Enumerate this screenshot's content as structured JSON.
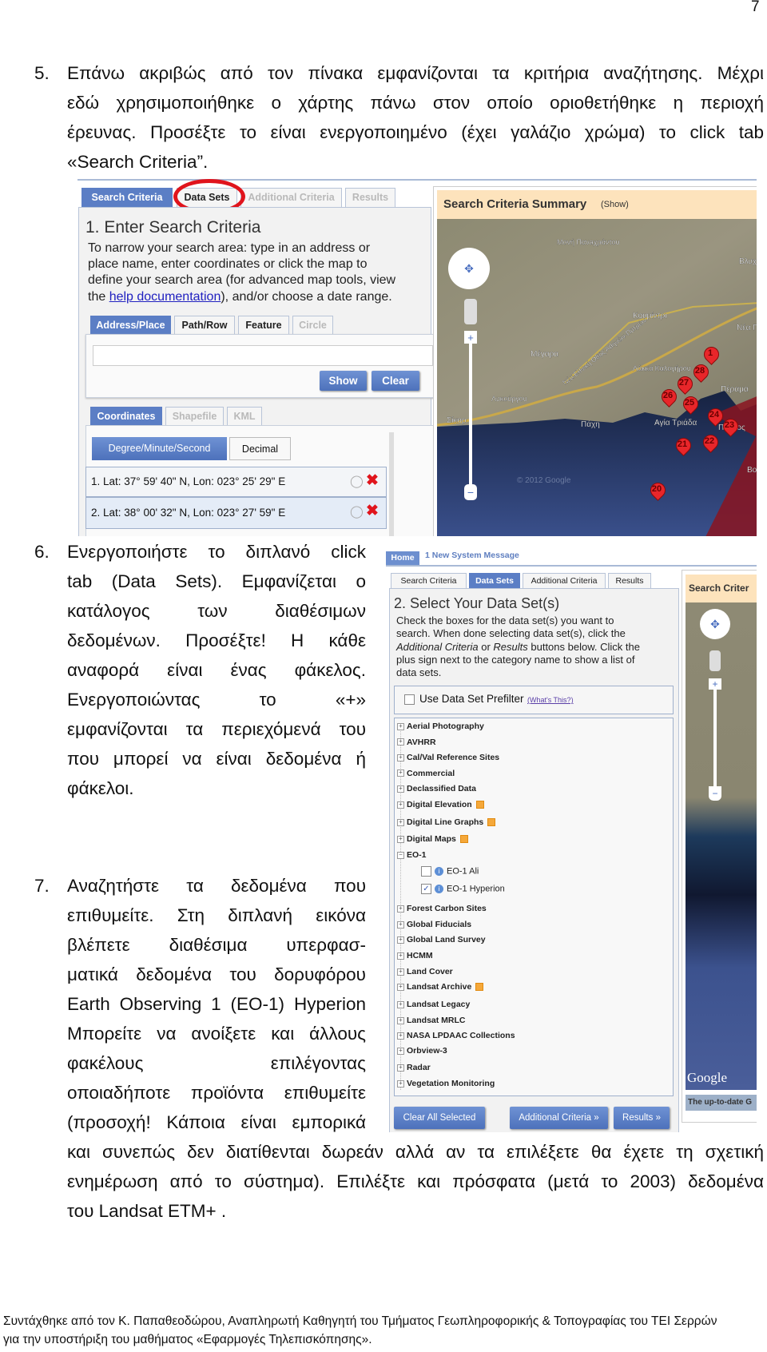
{
  "page_number": "7",
  "item5": {
    "number": "5.",
    "lines": [
      "Επάνω ακριβώς από τον πίνακα εμφανίζονται τα κριτήρια αναζήτησης. Μέχρι",
      "εδώ χρησιμοποιήθηκε ο χάρτης πάνω στον οποίο οριοθετήθηκε η περιοχή",
      "έρευνας. Προσέξτε το είναι ενεργοποιημένο (έχει γαλάζιο χρώμα) το click tab",
      "«Search Criteria”."
    ]
  },
  "shot1": {
    "tabs": [
      "Search Criteria",
      "Data Sets",
      "Additional Criteria",
      "Results"
    ],
    "active_tab": "Search Criteria",
    "highlight_color": "#e0141c",
    "heading": "1. Enter Search Criteria",
    "para": [
      "To narrow your search area: type in an address or",
      "place name, enter coordinates or click the map to",
      "define your search area (for advanced map tools, view"
    ],
    "para_last_pre": "the ",
    "help_link": "help documentation",
    "para_last_post": "), and/or choose a date range.",
    "subtabs": [
      "Address/Place",
      "Path/Row",
      "Feature",
      "Circle"
    ],
    "address_value": "",
    "show_button": "Show",
    "clear_button": "Clear",
    "coord_tabs": [
      "Coordinates",
      "Shapefile",
      "KML"
    ],
    "format_buttons": [
      "Degree/Minute/Second",
      "Decimal"
    ],
    "coordinates": [
      "1.  Lat: 37° 59' 40\" N, Lon: 023° 25' 29\" E",
      "2.  Lat: 38° 00' 32\" N, Lon: 023° 27' 59\" E"
    ],
    "summary_title": "Search Criteria Summary",
    "summary_show": "(Show)",
    "map_labels": [
      "Μονή Πανaχράντου",
      "Κουμίντρι",
      "Μέγαρα",
      "Λάκκα Καλογήρου",
      "Λυκούργου",
      "Σίκορ",
      "Πάχη",
      "Αγία Τριάδα",
      "Βλυχ",
      "Νέα Π",
      "Πέραμα",
      "Πύργος",
      "Βο",
      "Νέα Εθνική Οδός Αθηνών-Πατρών"
    ],
    "markers": [
      "1",
      "28",
      "27",
      "26",
      "25",
      "24",
      "23",
      "22",
      "21",
      "20"
    ],
    "watermark": "© 2012 Google"
  },
  "item6": {
    "number": "6.",
    "lines": [
      "Ενεργοποιήστε το διπλανό click",
      "tab (Data Sets). Εμφανίζεται ο",
      "κατάλογος των διαθέσιμων",
      "δεδομένων. Προσέξτε! Η κάθε",
      "αναφορά είναι ένας φάκελος.",
      "Ενεργοποιώντας το «+»",
      "εμφανίζονται τα περιεχόμενά του",
      "που μπορεί να είναι δεδομένα ή",
      "φάκελοι."
    ]
  },
  "shot2": {
    "home": "Home",
    "message": "1 New System Message",
    "tabs": [
      "Search Criteria",
      "Data Sets",
      "Additional Criteria",
      "Results"
    ],
    "active_tab": "Data Sets",
    "heading": "2. Select Your Data Set(s)",
    "para": [
      "Check the boxes for the data set(s) you want to",
      "search. When done selecting data set(s), click the"
    ],
    "para_i1": "Additional Criteria",
    "para_or": " or ",
    "para_i2": "Results",
    "para_rest": " buttons below. Click the",
    "para_tail": [
      "plus sign next to the category name to show a list of",
      "data sets."
    ],
    "prefilter_label": "Use Data Set Prefilter",
    "prefilter_checked": false,
    "whats_this": "(What's This?)",
    "categories_top": [
      {
        "label": "Aerial Photography",
        "flag": false
      },
      {
        "label": "AVHRR",
        "flag": false
      },
      {
        "label": "Cal/Val Reference Sites",
        "flag": false
      },
      {
        "label": "Commercial",
        "flag": false
      },
      {
        "label": "Declassified Data",
        "flag": false
      },
      {
        "label": "Digital Elevation",
        "flag": true
      },
      {
        "label": "Digital Line Graphs",
        "flag": true
      },
      {
        "label": "Digital Maps",
        "flag": true
      }
    ],
    "eo1": {
      "label": "EO-1",
      "children": [
        {
          "label": "EO-1 Ali",
          "checked": false
        },
        {
          "label": "EO-1 Hyperion",
          "checked": true
        }
      ]
    },
    "categories_bottom": [
      {
        "label": "Forest Carbon Sites",
        "flag": false
      },
      {
        "label": "Global Fiducials",
        "flag": false
      },
      {
        "label": "Global Land Survey",
        "flag": false
      },
      {
        "label": "HCMM",
        "flag": false
      },
      {
        "label": "Land Cover",
        "flag": false
      },
      {
        "label": "Landsat Archive",
        "flag": true
      },
      {
        "label": "Landsat Legacy",
        "flag": false
      },
      {
        "label": "Landsat MRLC",
        "flag": false
      },
      {
        "label": "NASA LPDAAC Collections",
        "flag": false
      },
      {
        "label": "Orbview-3",
        "flag": false
      },
      {
        "label": "Radar",
        "flag": false
      },
      {
        "label": "Vegetation Monitoring",
        "flag": false
      }
    ],
    "buttons": [
      "Clear All Selected",
      "Additional Criteria »",
      "Results »"
    ],
    "summary_title": "Search Criter",
    "google_logo": "Google",
    "banner": "The up-to-date G"
  },
  "item7": {
    "number": "7.",
    "lines": [
      "Αναζητήστε τα δεδομένα που",
      "επιθυμείτε. Στη διπλανή εικόνα",
      "βλέπετε διαθέσιμα υπερφασ-",
      "ματικά δεδομένα του δορυφόρου",
      "Earth Observing 1 (EO-1) Hyperion",
      "Μπορείτε να ανοίξετε και άλλους",
      "φακέλους επιλέγοντας",
      "οποιαδήποτε προϊόντα επιθυμείτε",
      "(προσοχή! Κάποια είναι εμπορικά"
    ],
    "wide_lines": [
      "και συνεπώς δεν διατίθενται δωρεάν αλλά αν τα επιλέξετε θα έχετε τη σχετική",
      "ενημέρωση από το σύστημα). Επιλέξτε και πρόσφατα (μετά το 2003) δεδομένα",
      "του Landsat ETM+ ."
    ]
  },
  "footer": [
    "Συντάχθηκε από τον Κ. Παπαθεοδώρου, Αναπληρωτή Καθηγητή του Τμήματος Γεωπληροφορικής & Τοπογραφίας του ΤΕΙ Σερρών",
    "για την υποστήριξη του μαθήματος «Εφαρμογές Τηλεπισκόπησης»."
  ]
}
